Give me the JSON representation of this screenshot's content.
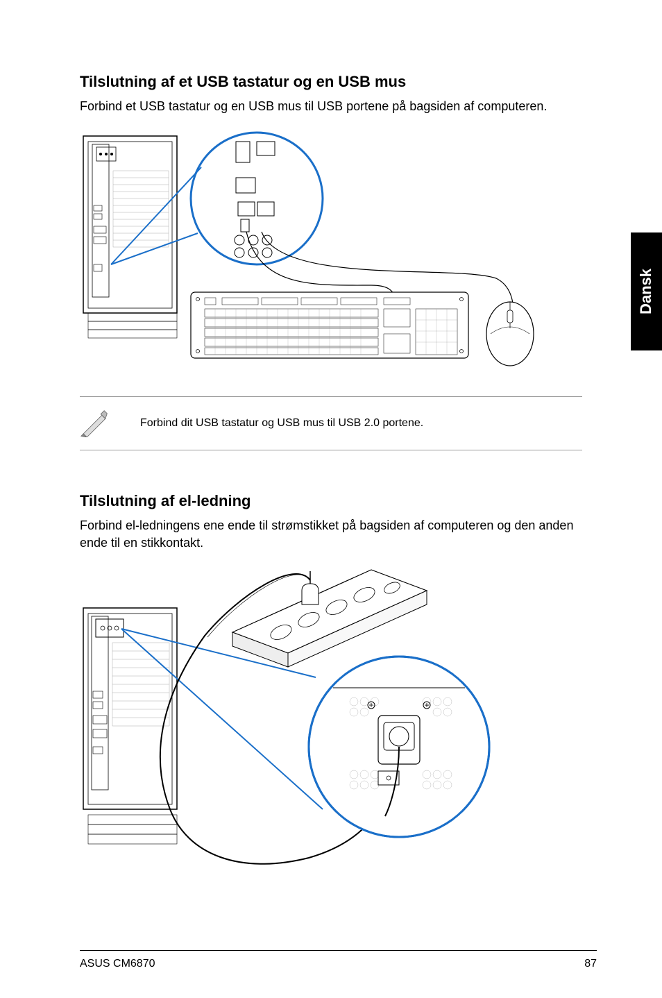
{
  "language_tab": "Dansk",
  "section1": {
    "heading": "Tilslutning af et USB tastatur og en USB mus",
    "body": "Forbind et USB tastatur og en USB mus til USB portene på bagsiden af computeren."
  },
  "note": {
    "text": "Forbind dit USB tastatur og USB mus til USB 2.0 portene."
  },
  "section2": {
    "heading": "Tilslutning af el-ledning",
    "body": "Forbind el-ledningens ene ende til strømstikket på bagsiden af computeren og den anden ende til en stikkontakt."
  },
  "footer": {
    "product": "ASUS CM6870",
    "page_number": "87"
  }
}
